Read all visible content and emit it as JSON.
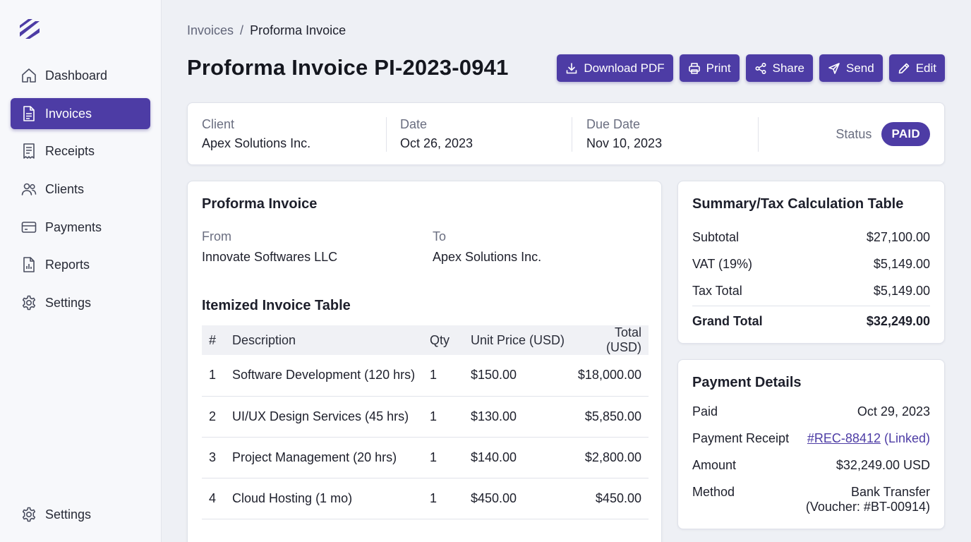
{
  "brand": {
    "accent": "#4d3ca5",
    "logo_icon": "brand-logo-icon"
  },
  "sidebar": {
    "items": [
      {
        "label": "Dashboard",
        "icon": "home-icon"
      },
      {
        "label": "Invoices",
        "icon": "document-icon",
        "active": true
      },
      {
        "label": "Receipts",
        "icon": "receipt-icon"
      },
      {
        "label": "Clients",
        "icon": "users-icon"
      },
      {
        "label": "Payments",
        "icon": "card-icon"
      },
      {
        "label": "Reports",
        "icon": "report-icon"
      },
      {
        "label": "Settings",
        "icon": "gear-icon"
      }
    ],
    "footer": {
      "label": "Settings",
      "icon": "gear-icon"
    }
  },
  "breadcrumb": {
    "parent": "Invoices",
    "separator": "/",
    "current": "Proforma Invoice"
  },
  "page": {
    "title": "Proforma Invoice PI-2023-0941"
  },
  "toolbar": {
    "download": "Download PDF",
    "print": "Print",
    "share": "Share",
    "send": "Send",
    "edit": "Edit"
  },
  "meta": {
    "client_label": "Client",
    "client": "Apex Solutions Inc.",
    "date_label": "Date",
    "date": "Oct 26, 2023",
    "due_label": "Due Date",
    "due": "Nov 10, 2023",
    "status_label": "Status",
    "status": "PAID",
    "status_color": "#4d3ca5"
  },
  "invoice": {
    "title": "Proforma Invoice",
    "from_label": "From",
    "from": "Innovate Softwares LLC",
    "to_label": "To",
    "to": "Apex Solutions Inc.",
    "table_title": "Itemized Invoice Table",
    "columns": [
      "#",
      "Description",
      "Qty",
      "Unit Price (USD)",
      "Total (USD)"
    ],
    "rows": [
      [
        "1",
        "Software Development (120 hrs)",
        "1",
        "$150.00",
        "$18,000.00"
      ],
      [
        "2",
        "UI/UX Design Services (45 hrs)",
        "1",
        "$130.00",
        "$5,850.00"
      ],
      [
        "3",
        "Project Management (20 hrs)",
        "1",
        "$140.00",
        "$2,800.00"
      ],
      [
        "4",
        "Cloud Hosting (1 mo)",
        "1",
        "$450.00",
        "$450.00"
      ]
    ]
  },
  "summary": {
    "title": "Summary/Tax Calculation Table",
    "subtotal_label": "Subtotal",
    "subtotal": "$27,100.00",
    "vat_label": "VAT (19%)",
    "vat": "$5,149.00",
    "tax_label": "Tax Total",
    "tax": "$5,149.00",
    "grand_label": "Grand Total",
    "grand": "$32,249.00"
  },
  "payment": {
    "title": "Payment Details",
    "paid_label": "Paid",
    "paid": "Oct 29, 2023",
    "receipt_label": "Payment Receipt",
    "receipt_link": "#REC-88412",
    "receipt_suffix": " (Linked)",
    "amount_label": "Amount",
    "amount": "$32,249.00 USD",
    "method_label": "Method",
    "method": "Bank Transfer",
    "voucher": "(Voucher: #BT-00914)"
  }
}
